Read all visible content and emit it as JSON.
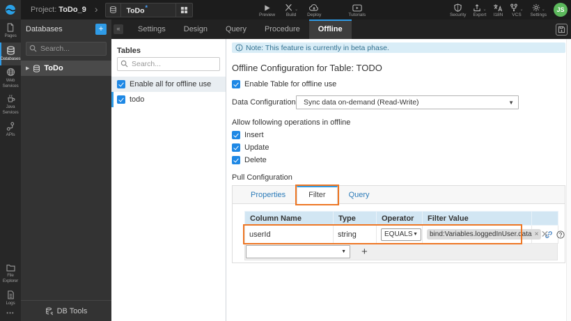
{
  "colors": {
    "accent_blue": "#2f9be6",
    "checkbox_blue": "#1e88e5",
    "highlight_orange": "#ee7623",
    "note_bg": "#d9edf7",
    "note_text": "#31708f",
    "avatar_green": "#5cb85c",
    "table_header_bg": "#d2e6f3",
    "topbar_bg": "#1c1c1c"
  },
  "topbar": {
    "project_prefix": "Project:",
    "project_name": "ToDo_9",
    "doc_tab": {
      "title": "ToDo",
      "modified": "*"
    },
    "actions": [
      {
        "label": "Preview"
      },
      {
        "label": "Build"
      },
      {
        "label": "Deploy"
      },
      {
        "label": "Tutorials"
      }
    ],
    "utilities": [
      {
        "label": "Security"
      },
      {
        "label": "Export"
      },
      {
        "label": "I18N"
      },
      {
        "label": "VCS"
      },
      {
        "label": "Settings"
      }
    ],
    "avatar": "JS"
  },
  "rail": {
    "items": [
      {
        "label": "Pages"
      },
      {
        "label": "Databases"
      },
      {
        "label": "Web Services"
      },
      {
        "label": "Java Services"
      },
      {
        "label": "APIs"
      }
    ],
    "bottom_items": [
      {
        "label": "File Explorer"
      },
      {
        "label": "Logs"
      }
    ],
    "more": "•••"
  },
  "db_panel": {
    "title": "Databases",
    "add_label": "+",
    "collapse_label": "«",
    "search_placeholder": "Search...",
    "item": "ToDo",
    "footer": "DB Tools"
  },
  "editor_tabs": {
    "items": [
      {
        "label": "Settings"
      },
      {
        "label": "Design"
      },
      {
        "label": "Query"
      },
      {
        "label": "Procedure"
      },
      {
        "label": "Offline"
      }
    ]
  },
  "tables_panel": {
    "title": "Tables",
    "search_placeholder": "Search...",
    "enable_all_label": "Enable all for offline use",
    "table_name": "todo"
  },
  "offline": {
    "note": "Note: This feature is currently in beta phase.",
    "heading": "Offline Configuration for Table: TODO",
    "enable_label": "Enable Table for offline use",
    "data_config_label": "Data Configuration",
    "data_config_value": "Sync data on-demand (Read-Write)",
    "operations_label": "Allow following operations in offline",
    "operations": [
      {
        "label": "Insert"
      },
      {
        "label": "Update"
      },
      {
        "label": "Delete"
      }
    ],
    "pull_label": "Pull Configuration",
    "pull_tabs": [
      {
        "label": "Properties"
      },
      {
        "label": "Filter"
      },
      {
        "label": "Query"
      }
    ],
    "filter_table": {
      "headers": [
        "Column Name",
        "Type",
        "Operator",
        "Filter Value"
      ],
      "row": {
        "column_name": "userId",
        "type": "string",
        "operator": "EQUALS",
        "filter_value": "bind:Variables.loggedInUser.data"
      },
      "add_label": "+"
    }
  }
}
